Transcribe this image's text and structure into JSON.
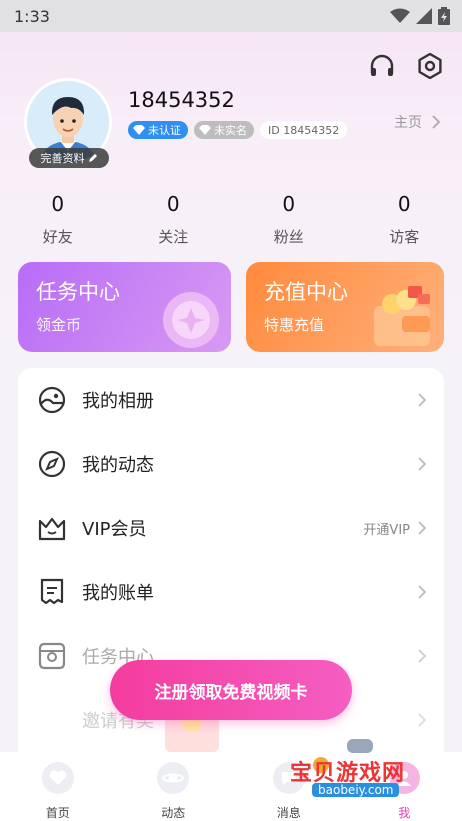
{
  "status_bar": {
    "time": "1:33"
  },
  "profile": {
    "edit_label": "完善资料",
    "username": "18454352",
    "badge_verify": "未认证",
    "badge_realname": "未实名",
    "badge_id": "ID 18454352",
    "homepage_label": "主页"
  },
  "stats": [
    {
      "value": "0",
      "label": "好友"
    },
    {
      "value": "0",
      "label": "关注"
    },
    {
      "value": "0",
      "label": "粉丝"
    },
    {
      "value": "0",
      "label": "访客"
    }
  ],
  "cards": {
    "task": {
      "title": "任务中心",
      "sub": "领金币"
    },
    "recharge": {
      "title": "充值中心",
      "sub": "特惠充值"
    }
  },
  "menu": [
    {
      "label": "我的相册",
      "extra": "",
      "icon": "album-icon"
    },
    {
      "label": "我的动态",
      "extra": "",
      "icon": "compass-icon"
    },
    {
      "label": "VIP会员",
      "extra": "开通VIP",
      "icon": "crown-icon"
    },
    {
      "label": "我的账单",
      "extra": "",
      "icon": "bill-icon"
    },
    {
      "label": "任务中心",
      "extra": "",
      "icon": "task-icon"
    },
    {
      "label": "邀请有奖",
      "extra": "",
      "icon": "invite-icon"
    }
  ],
  "float_button": "注册领取免费视频卡",
  "bottom_nav": [
    {
      "label": "首页"
    },
    {
      "label": "动态"
    },
    {
      "label": "消息"
    },
    {
      "label": "我"
    }
  ],
  "watermark": {
    "text": "宝贝游戏网",
    "url": "baobeiy.com"
  },
  "colors": {
    "accent": "#e43fb4",
    "verify": "#2f8ff3",
    "task_card": "#b86cf6",
    "recharge_card": "#ff8a3d"
  }
}
